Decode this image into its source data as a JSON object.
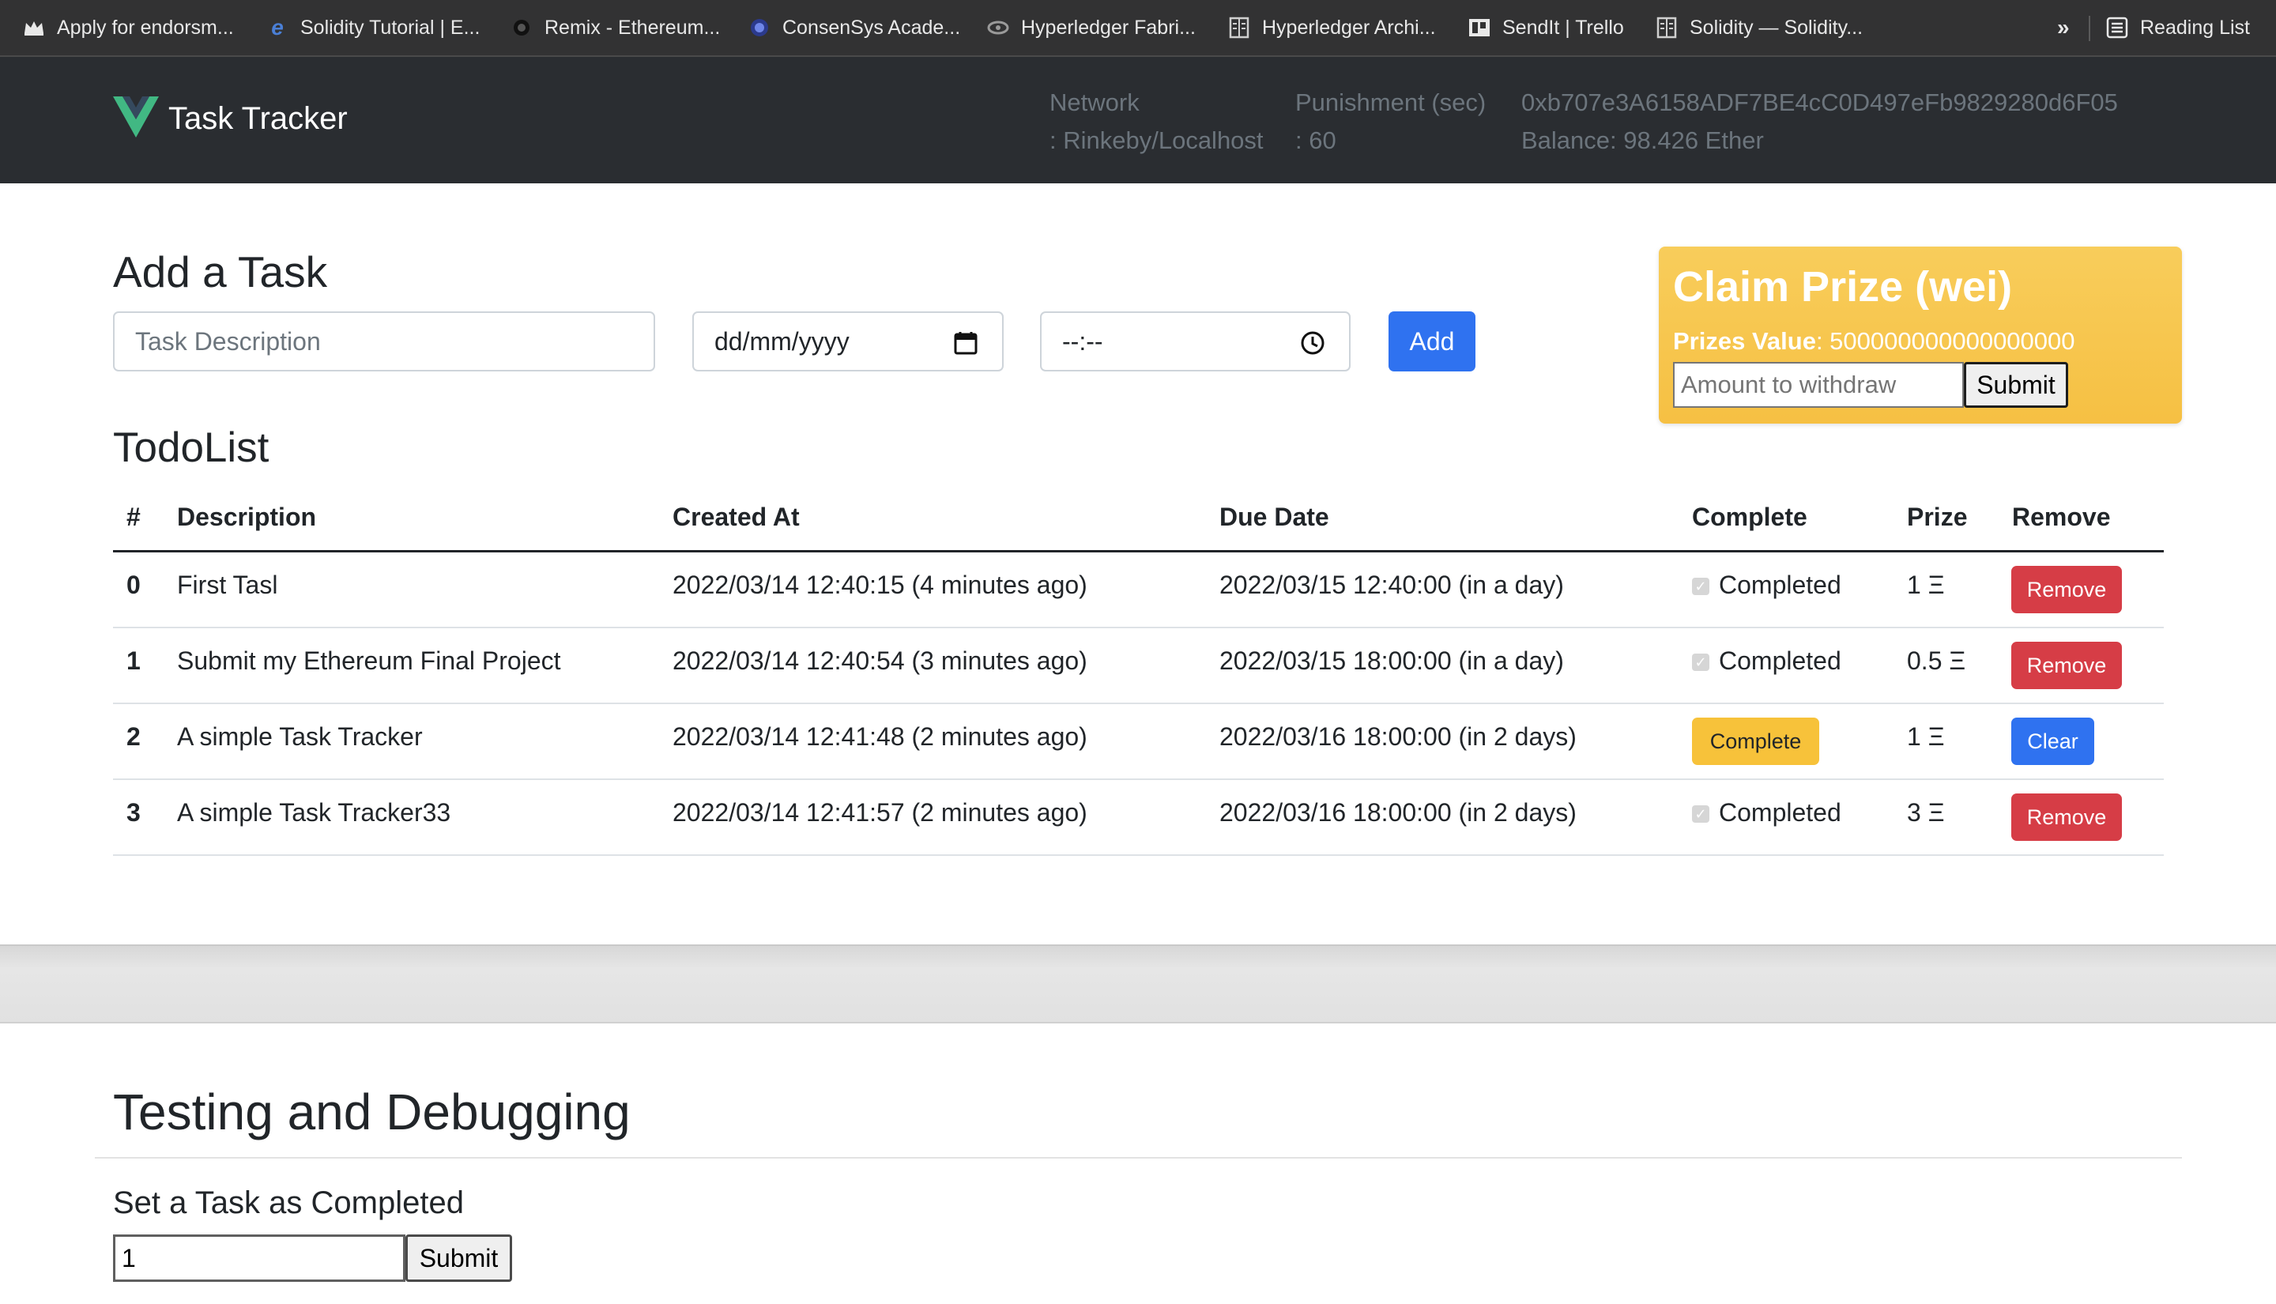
{
  "bookmarks": [
    {
      "label": "Apply for endorsm...",
      "icon": "crown-icon"
    },
    {
      "label": "Solidity Tutorial | E...",
      "icon": "e-logo-icon"
    },
    {
      "label": "Remix - Ethereum...",
      "icon": "remix-icon"
    },
    {
      "label": "ConsenSys Acade...",
      "icon": "consensys-icon"
    },
    {
      "label": "Hyperledger Fabri...",
      "icon": "hyperledger-icon"
    },
    {
      "label": "Hyperledger Archi...",
      "icon": "page-icon"
    },
    {
      "label": "SendIt | Trello",
      "icon": "trello-icon"
    },
    {
      "label": "Solidity — Solidity...",
      "icon": "page-icon"
    }
  ],
  "bookmarks_more": "»",
  "reading_list": "Reading List",
  "navbar": {
    "brand": "Task Tracker",
    "network_label": "Network",
    "network_value": ": Rinkeby/Localhost",
    "punishment_label": "Punishment (sec)",
    "punishment_value": ": 60",
    "address": "0xb707e3A6158ADF7BE4cC0D497eFb9829280d6F05",
    "balance": "Balance: 98.426 Ether"
  },
  "add_task": {
    "heading": "Add a Task",
    "description_placeholder": "Task Description",
    "date_placeholder": "dd/mm/yyyy",
    "time_placeholder": "--:--",
    "add_label": "Add"
  },
  "claim": {
    "title": "Claim Prize (wei)",
    "prizes_label": "Prizes Value",
    "prizes_value": ": 500000000000000000",
    "amount_placeholder": "Amount to withdraw",
    "submit_label": "Submit"
  },
  "todo": {
    "heading": "TodoList",
    "columns": [
      "#",
      "Description",
      "Created At",
      "Due Date",
      "Complete",
      "Prize",
      "Remove"
    ],
    "rows": [
      {
        "id": "0",
        "description": "First Tasl",
        "created": "2022/03/14 12:40:15 (4 minutes ago)",
        "due": "2022/03/15 12:40:00 (in a day)",
        "complete": "Completed",
        "prize": "1 Ξ",
        "action": "Remove"
      },
      {
        "id": "1",
        "description": "Submit my Ethereum Final Project",
        "created": "2022/03/14 12:40:54 (3 minutes ago)",
        "due": "2022/03/15 18:00:00 (in a day)",
        "complete": "Completed",
        "prize": "0.5 Ξ",
        "action": "Remove"
      },
      {
        "id": "2",
        "description": "A simple Task Tracker",
        "created": "2022/03/14 12:41:48 (2 minutes ago)",
        "due": "2022/03/16 18:00:00 (in 2 days)",
        "complete": "Complete",
        "prize": "1 Ξ",
        "action": "Clear"
      },
      {
        "id": "3",
        "description": "A simple Task Tracker33",
        "created": "2022/03/14 12:41:57 (2 minutes ago)",
        "due": "2022/03/16 18:00:00 (in 2 days)",
        "complete": "Completed",
        "prize": "3 Ξ",
        "action": "Remove"
      }
    ]
  },
  "debug": {
    "heading": "Testing and Debugging",
    "set_completed_heading": "Set a Task as Completed",
    "task_input_value": "1",
    "submit_label": "Submit"
  },
  "colors": {
    "navbar": "#2a2d31",
    "primary": "#2f72f0",
    "danger": "#d63d46",
    "warning": "#f7c23a",
    "vue_green": "#41b883",
    "vue_dark": "#35495e"
  }
}
